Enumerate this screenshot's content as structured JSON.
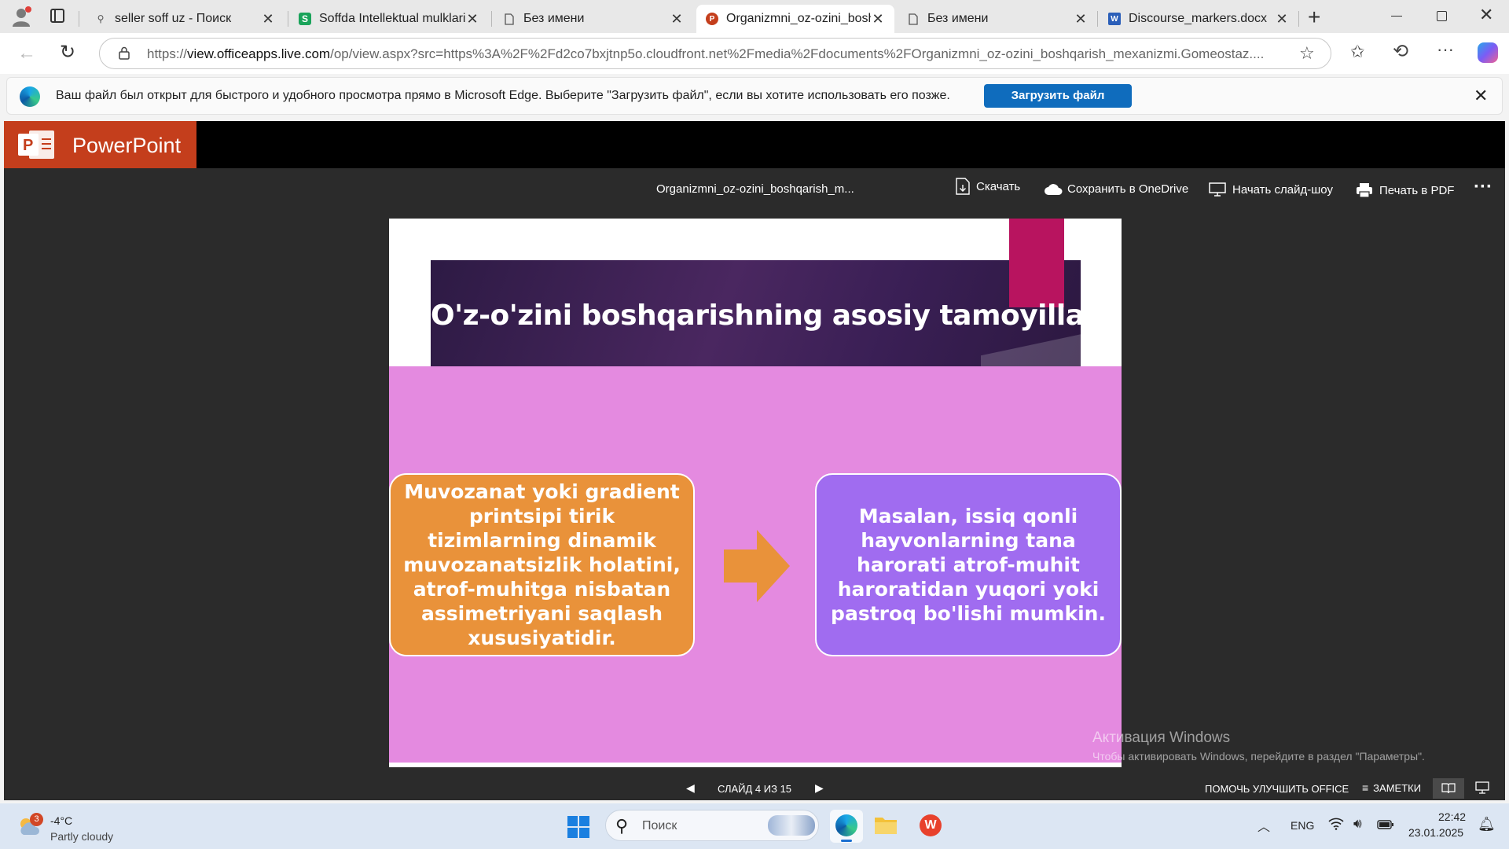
{
  "browser": {
    "tabs": [
      {
        "title": "seller soff uz - Поиск",
        "favicon": "search-icon",
        "active": false
      },
      {
        "title": "Soffda Intellektual mulklarini",
        "favicon": "soff-logo-icon",
        "active": false
      },
      {
        "title": "Без имени",
        "favicon": "page-icon",
        "active": false
      },
      {
        "title": "Organizmni_oz-ozini_boshqarish",
        "favicon": "powerpoint-icon",
        "active": true
      },
      {
        "title": "Без имени",
        "favicon": "page-icon",
        "active": false
      },
      {
        "title": "Discourse_markers.docx",
        "favicon": "word-icon",
        "active": false
      }
    ],
    "url_prefix": "https://",
    "url_host": "view.officeapps.live.com",
    "url_rest": "/op/view.aspx?src=https%3A%2F%2Fd2co7bxjtnp5o.cloudfront.net%2Fmedia%2Fdocuments%2FOrganizmni_oz-ozini_boshqarish_mexanizmi.Gomeostaz....",
    "infobar_message": "Ваш файл был открыт для быстрого и удобного просмотра прямо в Microsoft Edge. Выберите \"Загрузить файл\", если вы хотите использовать его позже.",
    "infobar_button": "Загрузить файл"
  },
  "viewer": {
    "app_name": "PowerPoint",
    "doc_title": "Organizmni_oz-ozini_boshqarish_m...",
    "commands": {
      "download": "Скачать",
      "save_onedrive": "Сохранить в OneDrive",
      "slideshow": "Начать слайд-шоу",
      "print_pdf": "Печать в PDF"
    },
    "slide": {
      "title": "O'z-o'zini boshqarishning asosiy tamoyillari.",
      "left_box": "Muvozanat yoki gradient printsipi tirik tizimlarning dinamik muvozanatsizlik holatini, atrof-muhitga nisbatan assimetriyani saqlash xususiyatidir.",
      "right_box": "Masalan, issiq qonli hayvonlarning tana harorati atrof-muhit haroratidan yuqori yoki pastroq bo'lishi mumkin.",
      "colors": {
        "background": "#e48ae0",
        "left_box": "#e9923a",
        "right_box": "#a06cf0",
        "accent": "#b8145f",
        "title_bg": "#3b1f4d"
      }
    },
    "status": {
      "slide_counter": "СЛАЙД 4 ИЗ 15",
      "help_improve": "ПОМОЧЬ УЛУЧШИТЬ OFFICE",
      "notes": "ЗАМЕТКИ"
    },
    "watermark": {
      "title": "Активация Windows",
      "subtitle": "Чтобы активировать Windows, перейдите в раздел \"Параметры\"."
    }
  },
  "taskbar": {
    "weather_temp": "-4°C",
    "weather_desc": "Partly cloudy",
    "weather_badge": "3",
    "search_placeholder": "Поиск",
    "language": "ENG",
    "time": "22:42",
    "date": "23.01.2025"
  }
}
